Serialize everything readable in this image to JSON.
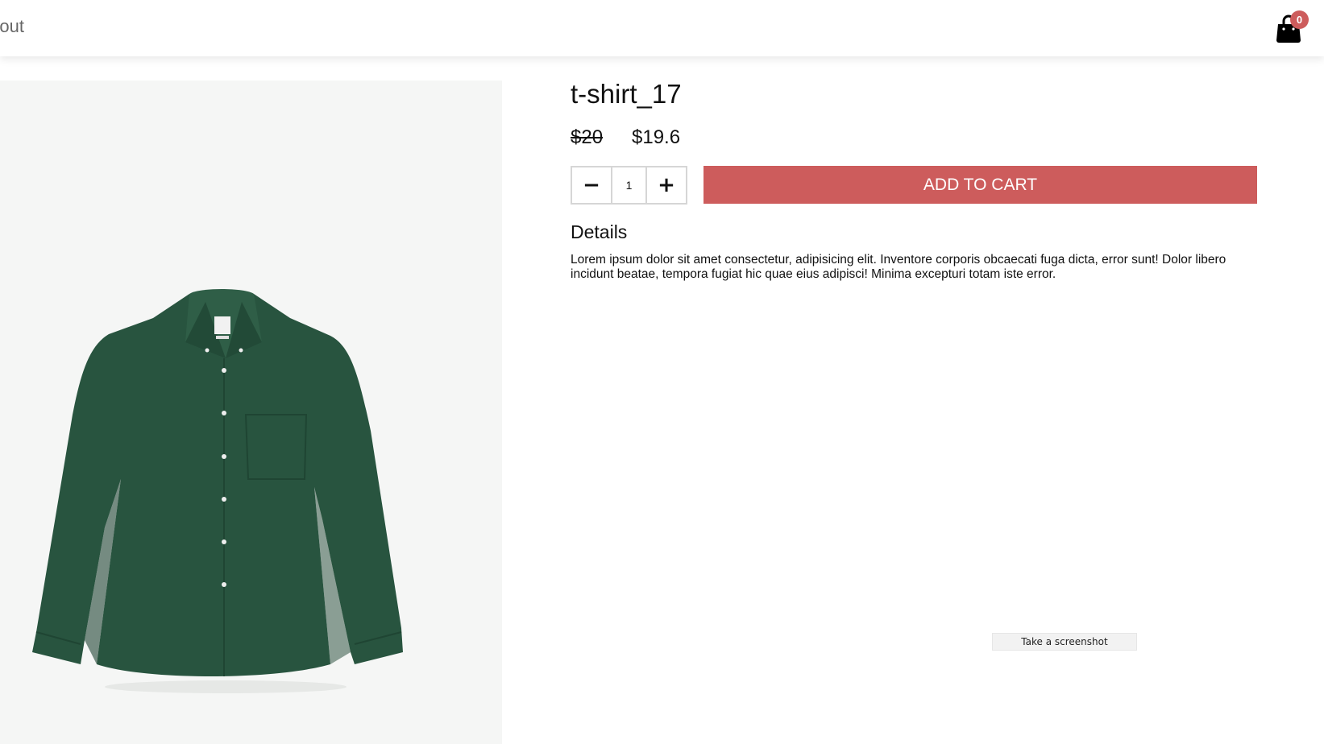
{
  "header": {
    "nav_link_label": "About",
    "cart_count": "0",
    "cart_icon": "shopping-bag-icon"
  },
  "product": {
    "title": "t-shirt_17",
    "original_price": "$20",
    "sale_price": "$19.6",
    "image_description_icon": "green-button-down-shirt",
    "quantity": "1",
    "decrement_label": "−",
    "increment_label": "+",
    "add_to_cart_label": "ADD TO CART",
    "details_heading": "Details",
    "details_text": "Lorem ipsum dolor sit amet consectetur, adipisicing elit. Inventore corporis obcaecati fuga dicta, error sunt! Dolor libero incidunt beatae, tempora fugiat hic quae eius adipisci! Minima excepturi totam iste error."
  },
  "tooltip": {
    "text": "Take a screenshot"
  },
  "colors": {
    "accent": "#cd5c5c",
    "image_background": "#f5f6f5",
    "shirt": "#28543f"
  }
}
